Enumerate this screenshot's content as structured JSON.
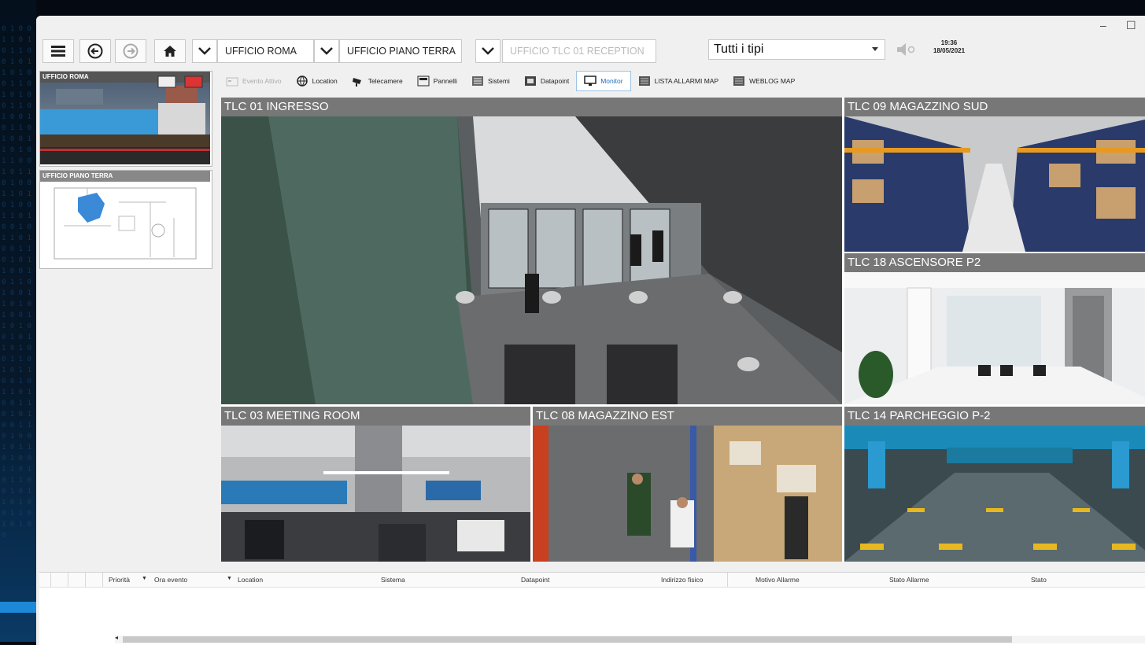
{
  "window": {
    "minimize_label": "–",
    "maximize_label": "☐"
  },
  "breadcrumbs": [
    {
      "label": "UFFICIO ROMA"
    },
    {
      "label": "UFFICIO PIANO TERRA"
    },
    {
      "label": "UFFICIO TLC 01 RECEPTION"
    }
  ],
  "filter": {
    "selected": "Tutti i tipi"
  },
  "clock": {
    "time": "19:36",
    "date": "18/05/2021"
  },
  "sidebar": {
    "thumbs": [
      {
        "label": "UFFICIO ROMA"
      },
      {
        "label": "UFFICIO PIANO TERRA"
      }
    ]
  },
  "tabs": [
    {
      "label": "Evento Attivo",
      "icon": "event-icon"
    },
    {
      "label": "Location",
      "icon": "globe-icon"
    },
    {
      "label": "Telecamere",
      "icon": "camera-icon"
    },
    {
      "label": "Pannelli",
      "icon": "panel-icon"
    },
    {
      "label": "Sistemi",
      "icon": "systems-icon"
    },
    {
      "label": "Datapoint",
      "icon": "datapoint-icon"
    },
    {
      "label": "Monitor",
      "icon": "monitor-icon"
    },
    {
      "label": "LISTA ALLARMI MAP",
      "icon": "list-icon"
    },
    {
      "label": "WEBLOG MAP",
      "icon": "list-icon"
    }
  ],
  "cameras": [
    {
      "title": "TLC 01 INGRESSO"
    },
    {
      "title": "TLC 09 MAGAZZINO SUD"
    },
    {
      "title": "TLC 18 ASCENSORE P2"
    },
    {
      "title": "TLC 03 MEETING ROOM"
    },
    {
      "title": "TLC 08 MAGAZZINO EST"
    },
    {
      "title": "TLC 14 PARCHEGGIO P-2"
    }
  ],
  "alarm_table": {
    "columns": [
      "Priorità",
      "Ora evento",
      "Location",
      "Sistema",
      "Datapoint",
      "Indirizzo fisico",
      "Motivo Allarme",
      "Stato Allarme",
      "Stato"
    ],
    "rows": []
  }
}
